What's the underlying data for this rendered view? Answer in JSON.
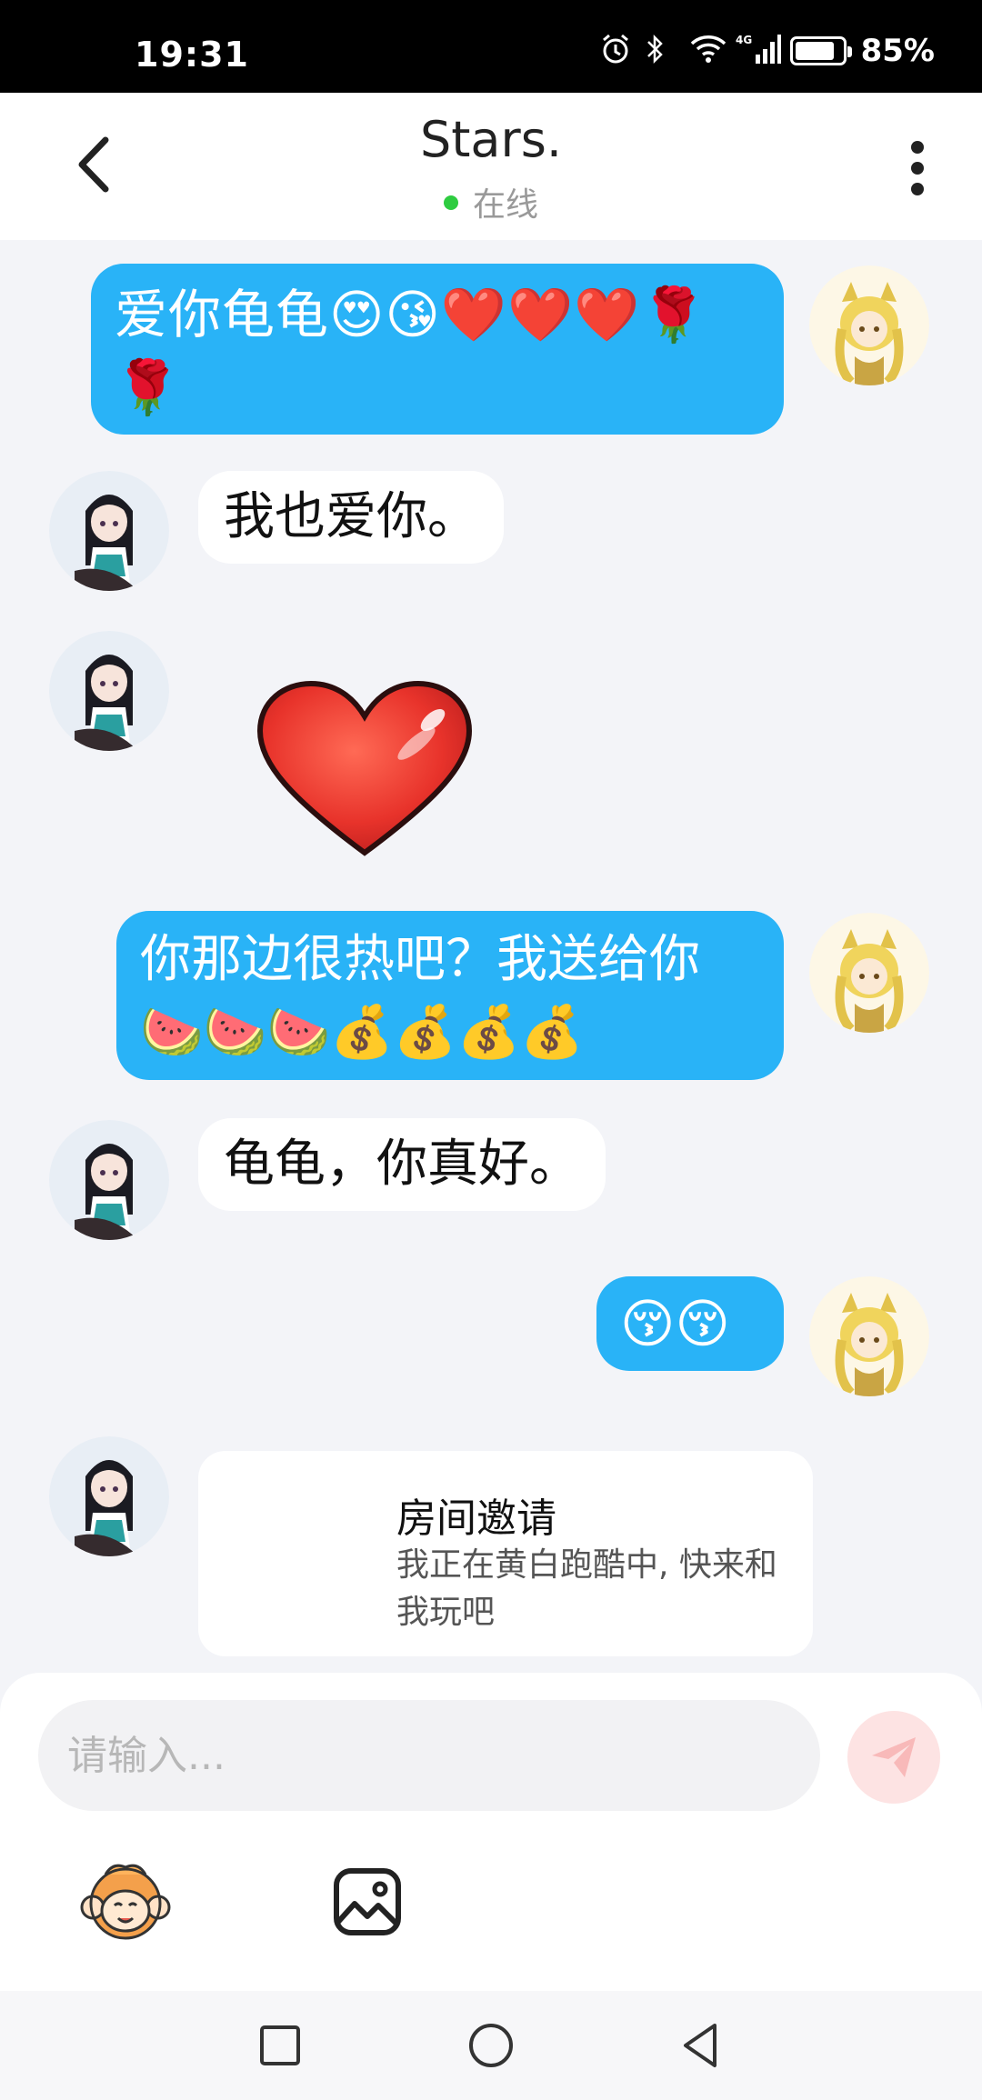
{
  "status_bar": {
    "time": "19:31",
    "network": "4G",
    "battery": "85%"
  },
  "header": {
    "title": "Stars.",
    "online": "在线"
  },
  "messages": [
    {
      "from": "me",
      "text": "爱你龟龟😍😘❤️❤️❤️🌹🌹"
    },
    {
      "from": "them",
      "text": "我也爱你。"
    },
    {
      "from": "them",
      "sticker": "heart-sticker"
    },
    {
      "from": "me",
      "text": "你那边很热吧？我送给你🍉🍉🍉💰💰💰💰"
    },
    {
      "from": "them",
      "text": "龟龟，你真好。"
    },
    {
      "from": "me",
      "text": "😚😚"
    }
  ],
  "invite_card": {
    "title": "房间邀请",
    "desc": "我正在黄白跑酷中, 快来和我玩吧"
  },
  "composer": {
    "placeholder": "请输入..."
  },
  "colors": {
    "my_bubble": "#29b3f7",
    "their_bubble": "#ffffff",
    "online_dot": "#2ecc40",
    "send_button": "#fde3e3"
  }
}
